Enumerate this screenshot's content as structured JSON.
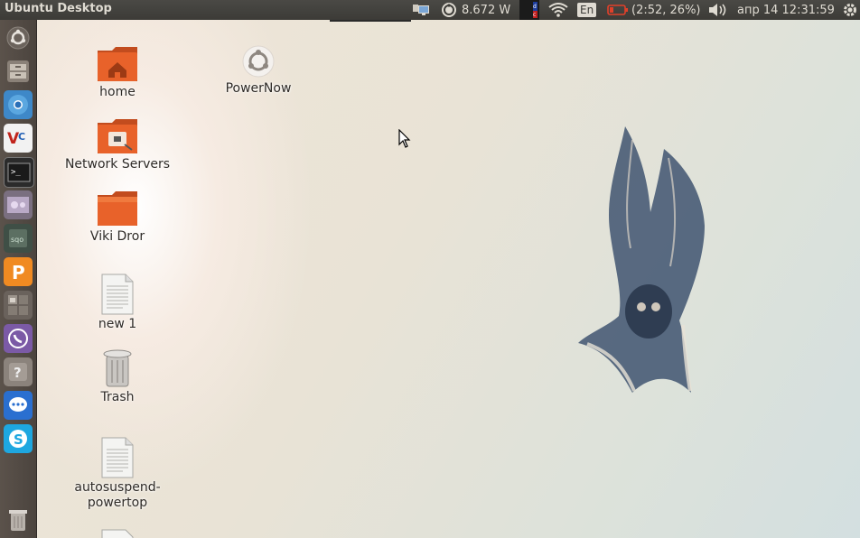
{
  "top_panel": {
    "app_title": "Ubuntu Desktop",
    "power": "8.672 W",
    "keyboard_layout": "En",
    "battery": "(2:52, 26%)",
    "datetime": "апр 14 12:31:59",
    "icons": [
      "network-monitor-icon",
      "powernow-indicator-icon",
      "cpu-indicator-icon",
      "wifi-icon",
      "battery-icon",
      "volume-icon",
      "gear-icon"
    ]
  },
  "launcher": {
    "items": [
      "dash-home",
      "file-manager",
      "chromium",
      "vscode",
      "terminal",
      "photos",
      "sqlite",
      "powernow",
      "workspace-switcher",
      "viber",
      "help",
      "messenger",
      "skype",
      "trash"
    ]
  },
  "desktop": {
    "icons": [
      {
        "label": "home",
        "type": "folder-home"
      },
      {
        "label": "PowerNow",
        "type": "ubuntu-app"
      },
      {
        "label": "Network Servers",
        "type": "folder-network"
      },
      {
        "label": "Viki Dror",
        "type": "folder"
      },
      {
        "label": "new 1",
        "type": "text-file"
      },
      {
        "label": "Trash",
        "type": "trash"
      },
      {
        "label": "autosuspend-",
        "label2": "powertop",
        "type": "text-file"
      }
    ]
  },
  "colors": {
    "panel": "#3c3b37",
    "launcher": "#4b443e",
    "folder_orange": "#e8622a",
    "battery_red": "#e0402a"
  }
}
